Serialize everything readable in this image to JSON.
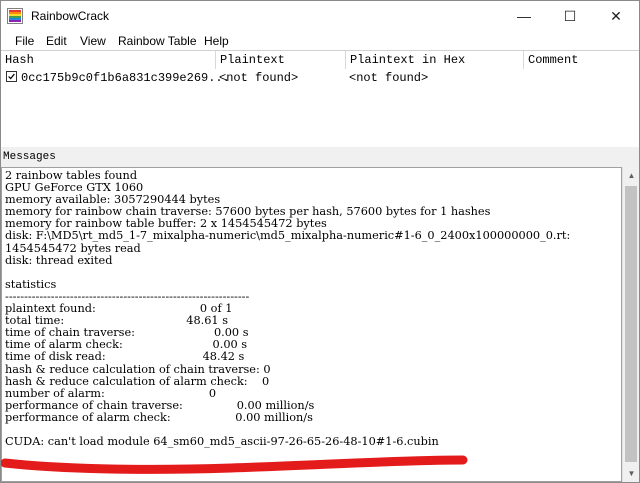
{
  "window": {
    "title": "RainbowCrack",
    "minimize_glyph": "—",
    "maximize_glyph": "☐",
    "close_glyph": "✕"
  },
  "icons": {
    "app": "rainbowcrack-app-icon",
    "checkbox": "checkbox-checked-icon",
    "scroll_up": "scroll-up-arrow-icon",
    "scroll_down": "scroll-down-arrow-icon"
  },
  "menu": {
    "file": "File",
    "edit": "Edit",
    "view": "View",
    "rainbow_table": "Rainbow Table",
    "help": "Help"
  },
  "hash_table": {
    "headers": {
      "hash": "Hash",
      "plaintext": "Plaintext",
      "plaintext_hex": "Plaintext in Hex",
      "comment": "Comment"
    },
    "row": {
      "checked": true,
      "hash": "0cc175b9c0f1b6a831c399e269...",
      "plaintext": "<not found>",
      "plaintext_hex": "<not found>",
      "comment": ""
    }
  },
  "messages": {
    "label": "Messages",
    "text": "2 rainbow tables found\nGPU GeForce GTX 1060\nmemory available: 3057290444 bytes\nmemory for rainbow chain traverse: 57600 bytes per hash, 57600 bytes for 1 hashes\nmemory for rainbow table buffer: 2 x 1454545472 bytes\ndisk: F:\\MD5\\rt_md5_1-7_mixalpha-numeric\\md5_mixalpha-numeric#1-6_0_2400x100000000_0.rt:\n1454545472 bytes read\ndisk: thread exited\n\nstatistics\n----------------------------------------------------------------\nplaintext found:                             0 of 1\ntotal time:                                  48.61 s\ntime of chain traverse:                      0.00 s\ntime of alarm check:                         0.00 s\ntime of disk read:                           48.42 s\nhash & reduce calculation of chain traverse: 0\nhash & reduce calculation of alarm check:    0\nnumber of alarm:                             0\nperformance of chain traverse:               0.00 million/s\nperformance of alarm check:                  0.00 million/s\n\nCUDA: can't load module 64_sm60_md5_ascii-97-26-65-26-48-10#1-6.cubin"
  },
  "colors": {
    "annotation_red": "#e41b1b",
    "window_bg": "#f0f0f0",
    "list_bg": "#ffffff"
  }
}
